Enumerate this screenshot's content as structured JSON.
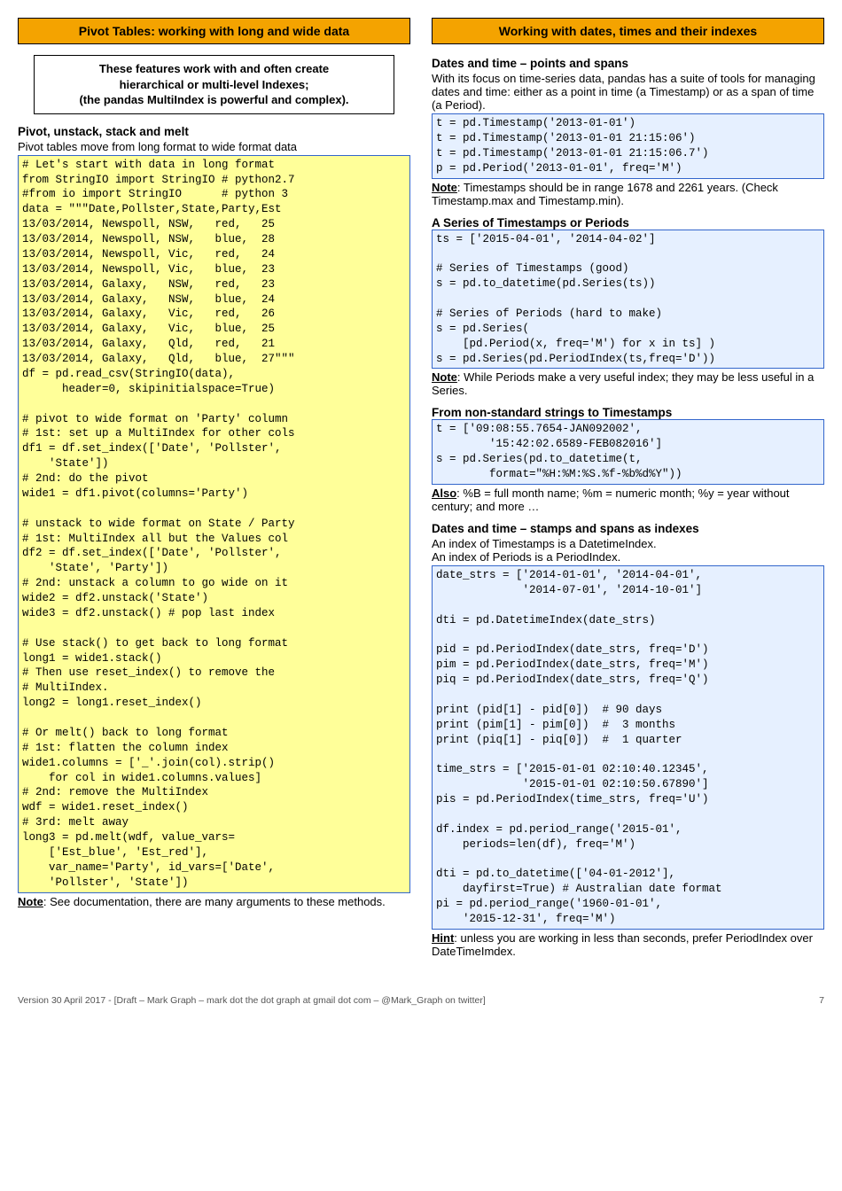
{
  "left": {
    "header": "Pivot Tables: working with long and wide data",
    "callout": "These features work with and often create\nhierarchical or multi-level Indexes;\n(the pandas MultiIndex is powerful and complex).",
    "sec1_title": "Pivot, unstack, stack and melt",
    "sec1_intro": "Pivot tables move from long format to wide format data",
    "code1": "# Let's start with data in long format\nfrom StringIO import StringIO # python2.7\n#from io import StringIO      # python 3\ndata = \"\"\"Date,Pollster,State,Party,Est\n13/03/2014, Newspoll, NSW,   red,   25\n13/03/2014, Newspoll, NSW,   blue,  28\n13/03/2014, Newspoll, Vic,   red,   24\n13/03/2014, Newspoll, Vic,   blue,  23\n13/03/2014, Galaxy,   NSW,   red,   23\n13/03/2014, Galaxy,   NSW,   blue,  24\n13/03/2014, Galaxy,   Vic,   red,   26\n13/03/2014, Galaxy,   Vic,   blue,  25\n13/03/2014, Galaxy,   Qld,   red,   21\n13/03/2014, Galaxy,   Qld,   blue,  27\"\"\"\ndf = pd.read_csv(StringIO(data),\n      header=0, skipinitialspace=True)\n\n# pivot to wide format on 'Party' column\n# 1st: set up a MultiIndex for other cols\ndf1 = df.set_index(['Date', 'Pollster',\n    'State'])\n# 2nd: do the pivot\nwide1 = df1.pivot(columns='Party')\n\n# unstack to wide format on State / Party\n# 1st: MultiIndex all but the Values col\ndf2 = df.set_index(['Date', 'Pollster',\n    'State', 'Party'])\n# 2nd: unstack a column to go wide on it\nwide2 = df2.unstack('State')\nwide3 = df2.unstack() # pop last index\n\n# Use stack() to get back to long format\nlong1 = wide1.stack()\n# Then use reset_index() to remove the\n# MultiIndex.\nlong2 = long1.reset_index()\n\n# Or melt() back to long format\n# 1st: flatten the column index\nwide1.columns = ['_'.join(col).strip()\n    for col in wide1.columns.values]\n# 2nd: remove the MultiIndex\nwdf = wide1.reset_index()\n# 3rd: melt away\nlong3 = pd.melt(wdf, value_vars=\n    ['Est_blue', 'Est_red'],\n    var_name='Party', id_vars=['Date',\n    'Pollster', 'State'])",
    "note1_label": "Note",
    "note1_text": ": See documentation, there are many arguments to these methods."
  },
  "right": {
    "header": "Working with dates, times and their indexes",
    "sec1_title": "Dates and time – points and spans",
    "sec1_intro": "With its focus on time-series data, pandas has a suite of tools for managing dates and time: either as a point in time (a Timestamp) or as a span of time (a Period).",
    "code1": "t = pd.Timestamp('2013-01-01')\nt = pd.Timestamp('2013-01-01 21:15:06')\nt = pd.Timestamp('2013-01-01 21:15:06.7')\np = pd.Period('2013-01-01', freq='M')",
    "note1_label": "Note",
    "note1_text": ": Timestamps should be in range 1678 and 2261 years. (Check Timestamp.max and Timestamp.min).",
    "sec2_title": "A Series of Timestamps or Periods",
    "code2": "ts = ['2015-04-01', '2014-04-02']\n\n# Series of Timestamps (good)\ns = pd.to_datetime(pd.Series(ts))\n\n# Series of Periods (hard to make)\ns = pd.Series(\n    [pd.Period(x, freq='M') for x in ts] )\ns = pd.Series(pd.PeriodIndex(ts,freq='D'))",
    "note2_label": "Note",
    "note2_text": ": While Periods make a very useful index; they may be less useful in a Series.",
    "sec3_title": "From non-standard strings to Timestamps",
    "code3": "t = ['09:08:55.7654-JAN092002',\n        '15:42:02.6589-FEB082016']\ns = pd.Series(pd.to_datetime(t,\n        format=\"%H:%M:%S.%f-%b%d%Y\"))",
    "note3_label": "Also",
    "note3_text": ": %B = full month name; %m = numeric month; %y = year without century; and more …",
    "sec4_title": "Dates and time – stamps and spans as indexes",
    "sec4_intro": "An index of Timestamps is a DatetimeIndex.\nAn index of Periods is a PeriodIndex.",
    "code4": "date_strs = ['2014-01-01', '2014-04-01',\n             '2014-07-01', '2014-10-01']\n\ndti = pd.DatetimeIndex(date_strs)\n\npid = pd.PeriodIndex(date_strs, freq='D')\npim = pd.PeriodIndex(date_strs, freq='M')\npiq = pd.PeriodIndex(date_strs, freq='Q')\n\nprint (pid[1] - pid[0])  # 90 days\nprint (pim[1] - pim[0])  #  3 months\nprint (piq[1] - piq[0])  #  1 quarter\n\ntime_strs = ['2015-01-01 02:10:40.12345',\n             '2015-01-01 02:10:50.67890']\npis = pd.PeriodIndex(time_strs, freq='U')\n\ndf.index = pd.period_range('2015-01',\n    periods=len(df), freq='M')\n\ndti = pd.to_datetime(['04-01-2012'],\n    dayfirst=True) # Australian date format\npi = pd.period_range('1960-01-01',\n    '2015-12-31', freq='M')",
    "note4_label": "Hint",
    "note4_text": ": unless you are working in less than seconds, prefer PeriodIndex over DateTimeImdex."
  },
  "footer": {
    "left": "Version 30 April 2017 - [Draft – Mark Graph – mark dot the dot graph at gmail dot com – @Mark_Graph on twitter]",
    "right": "7"
  }
}
